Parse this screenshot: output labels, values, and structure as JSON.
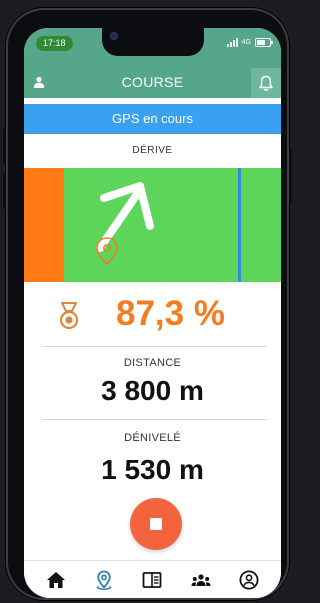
{
  "status_bar": {
    "time": "17:18",
    "network": "4G"
  },
  "app_bar": {
    "title": "COURSE"
  },
  "gps_banner": {
    "text": "GPS en cours"
  },
  "derive": {
    "label": "DÉRIVE"
  },
  "score": {
    "value": "87,3 %"
  },
  "distance": {
    "label": "DISTANCE",
    "value": "3 800 m"
  },
  "elevation": {
    "label": "DÉNIVELÉ",
    "value": "1 530 m"
  },
  "colors": {
    "primary": "#56a78a",
    "gps_blue": "#3aa0f0",
    "field_green": "#5dd45a",
    "drift_orange": "#ff7a14",
    "score_orange": "#f57c1f",
    "stop_red": "#f2633e"
  },
  "icons": {
    "user": "user-icon",
    "notifications": "bell-icon",
    "direction_arrow": "arrow-up-right-icon",
    "position_marker": "map-pin-icon",
    "medal": "medal-icon",
    "stop": "stop-icon",
    "tabs": [
      "home-icon",
      "map-pin-icon",
      "book-icon",
      "team-icon",
      "profile-icon"
    ]
  },
  "tabs": {
    "active_index": 1
  }
}
